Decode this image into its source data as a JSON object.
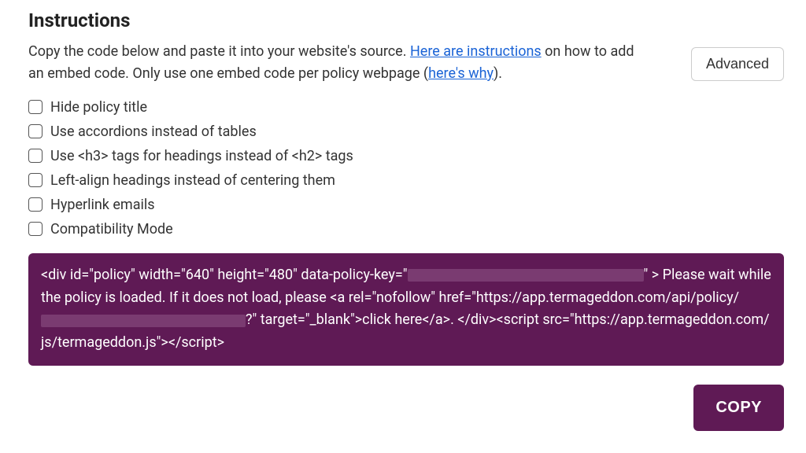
{
  "header": {
    "title": "Instructions",
    "intro_before_link1": "Copy the code below and paste it into your website's source. ",
    "link1": "Here are instructions",
    "intro_after_link1": " on how to add an embed code. Only use one embed code per policy webpage (",
    "link2": "here's why",
    "intro_after_link2": ")."
  },
  "advanced_button": "Advanced",
  "options": [
    "Hide policy title",
    "Use accordions instead of tables",
    "Use <h3> tags for headings instead of <h2> tags",
    "Left-align headings instead of centering them",
    "Hyperlink emails",
    "Compatibility Mode"
  ],
  "code": {
    "part1": "<div id=\"policy\" width=\"640\" height=\"480\" data-policy-key=\"",
    "part2": "\" > Please wait while the policy is loaded. If it does not load, please <a rel=\"nofollow\" href=\"https://app.termageddon.com/api/policy/",
    "part3": "?\" target=\"_blank\">click here</a>. </div><script src=\"https://app.termageddon.com/js/termageddon.js\"></script>"
  },
  "copy_button": "COPY"
}
